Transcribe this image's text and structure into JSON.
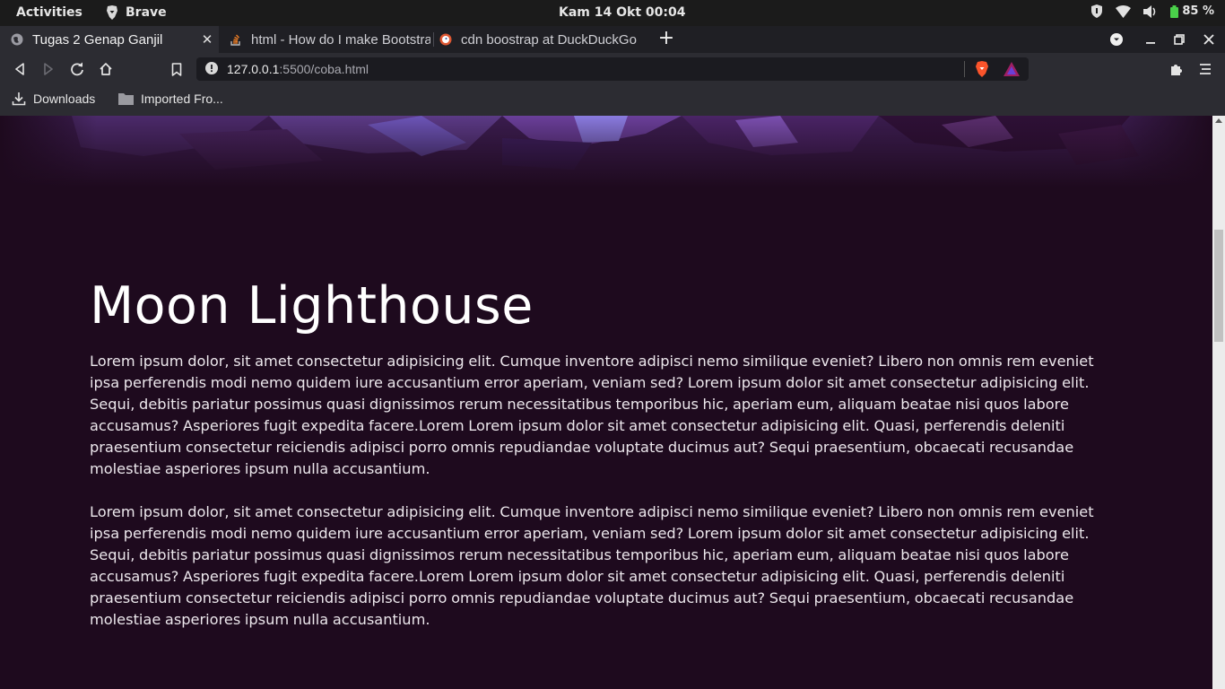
{
  "system_bar": {
    "activities": "Activities",
    "app_name": "Brave",
    "clock": "Kam 14 Okt  00:04",
    "battery": "85 %"
  },
  "tabs": [
    {
      "title": "Tugas 2 Genap Ganjil",
      "active": true
    },
    {
      "title": "html - How do I make Bootstrap",
      "active": false
    },
    {
      "title": "cdn boostrap at DuckDuckGo",
      "active": false
    }
  ],
  "toolbar": {
    "url_host": "127.0.0.1",
    "url_rest": ":5500/coba.html"
  },
  "bookmarks": [
    {
      "label": "Downloads"
    },
    {
      "label": "Imported Fro..."
    }
  ],
  "page": {
    "heading": "Moon Lighthouse",
    "paragraphs": [
      "Lorem ipsum dolor, sit amet consectetur adipisicing elit. Cumque inventore adipisci nemo similique eveniet? Libero non omnis rem eveniet ipsa perferendis modi nemo quidem iure accusantium error aperiam, veniam sed? Lorem ipsum dolor sit amet consectetur adipisicing elit. Sequi, debitis pariatur possimus quasi dignissimos rerum necessitatibus temporibus hic, aperiam eum, aliquam beatae nisi quos labore accusamus? Asperiores fugit expedita facere.Lorem Lorem ipsum dolor sit amet consectetur adipisicing elit. Quasi, perferendis deleniti praesentium consectetur reiciendis adipisci porro omnis repudiandae voluptate ducimus aut? Sequi praesentium, obcaecati recusandae molestiae asperiores ipsum nulla accusantium.",
      "Lorem ipsum dolor, sit amet consectetur adipisicing elit. Cumque inventore adipisci nemo similique eveniet? Libero non omnis rem eveniet ipsa perferendis modi nemo quidem iure accusantium error aperiam, veniam sed? Lorem ipsum dolor sit amet consectetur adipisicing elit. Sequi, debitis pariatur possimus quasi dignissimos rerum necessitatibus temporibus hic, aperiam eum, aliquam beatae nisi quos labore accusamus? Asperiores fugit expedita facere.Lorem Lorem ipsum dolor sit amet consectetur adipisicing elit. Quasi, perferendis deleniti praesentium consectetur reiciendis adipisci porro omnis repudiandae voluptate ducimus aut? Sequi praesentium, obcaecati recusandae molestiae asperiores ipsum nulla accusantium."
    ]
  },
  "colors": {
    "page_background": "#1e0a1e",
    "chrome_background": "#2c2c32",
    "tabstrip_background": "#1f1f24"
  }
}
